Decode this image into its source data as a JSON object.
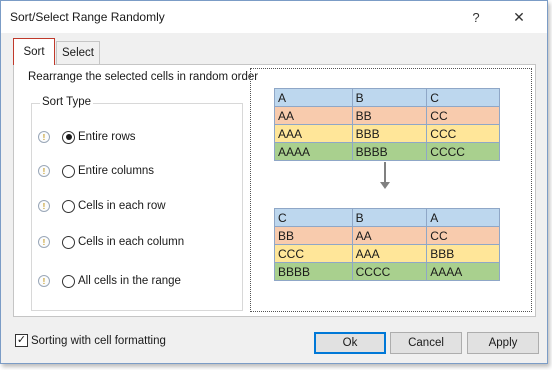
{
  "window": {
    "title": "Sort/Select Range Randomly",
    "help_glyph": "?",
    "close_glyph": "✕"
  },
  "tabs": [
    {
      "label": "Sort",
      "active": true
    },
    {
      "label": "Select",
      "active": false
    }
  ],
  "sort_panel": {
    "description": "Rearrange the selected cells in random order",
    "sort_type_legend": "Sort Type",
    "options": [
      {
        "label": "Entire rows",
        "checked": true
      },
      {
        "label": "Entire columns",
        "checked": false
      },
      {
        "label": "Cells in each row",
        "checked": false
      },
      {
        "label": "Cells in each column",
        "checked": false
      },
      {
        "label": "All cells in the range",
        "checked": false
      }
    ],
    "info_glyph": "!"
  },
  "preview": {
    "before": [
      [
        "A",
        "B",
        "C"
      ],
      [
        "AA",
        "BB",
        "CC"
      ],
      [
        "AAA",
        "BBB",
        "CCC"
      ],
      [
        "AAAA",
        "BBBB",
        "CCCC"
      ]
    ],
    "after": [
      [
        "C",
        "B",
        "A"
      ],
      [
        "BB",
        "AA",
        "CC"
      ],
      [
        "CCC",
        "AAA",
        "BBB"
      ],
      [
        "BBBB",
        "CCCC",
        "AAAA"
      ]
    ],
    "colors": {
      "blue": "#bdd7ee",
      "orange": "#f8cbad",
      "yellow": "#ffe699",
      "green": "#a9d08e"
    }
  },
  "footer": {
    "checkbox_label": "Sorting with cell formatting",
    "checkbox_checked": true,
    "check_glyph": "✓",
    "ok_label": "Ok",
    "cancel_label": "Cancel",
    "apply_label": "Apply"
  }
}
